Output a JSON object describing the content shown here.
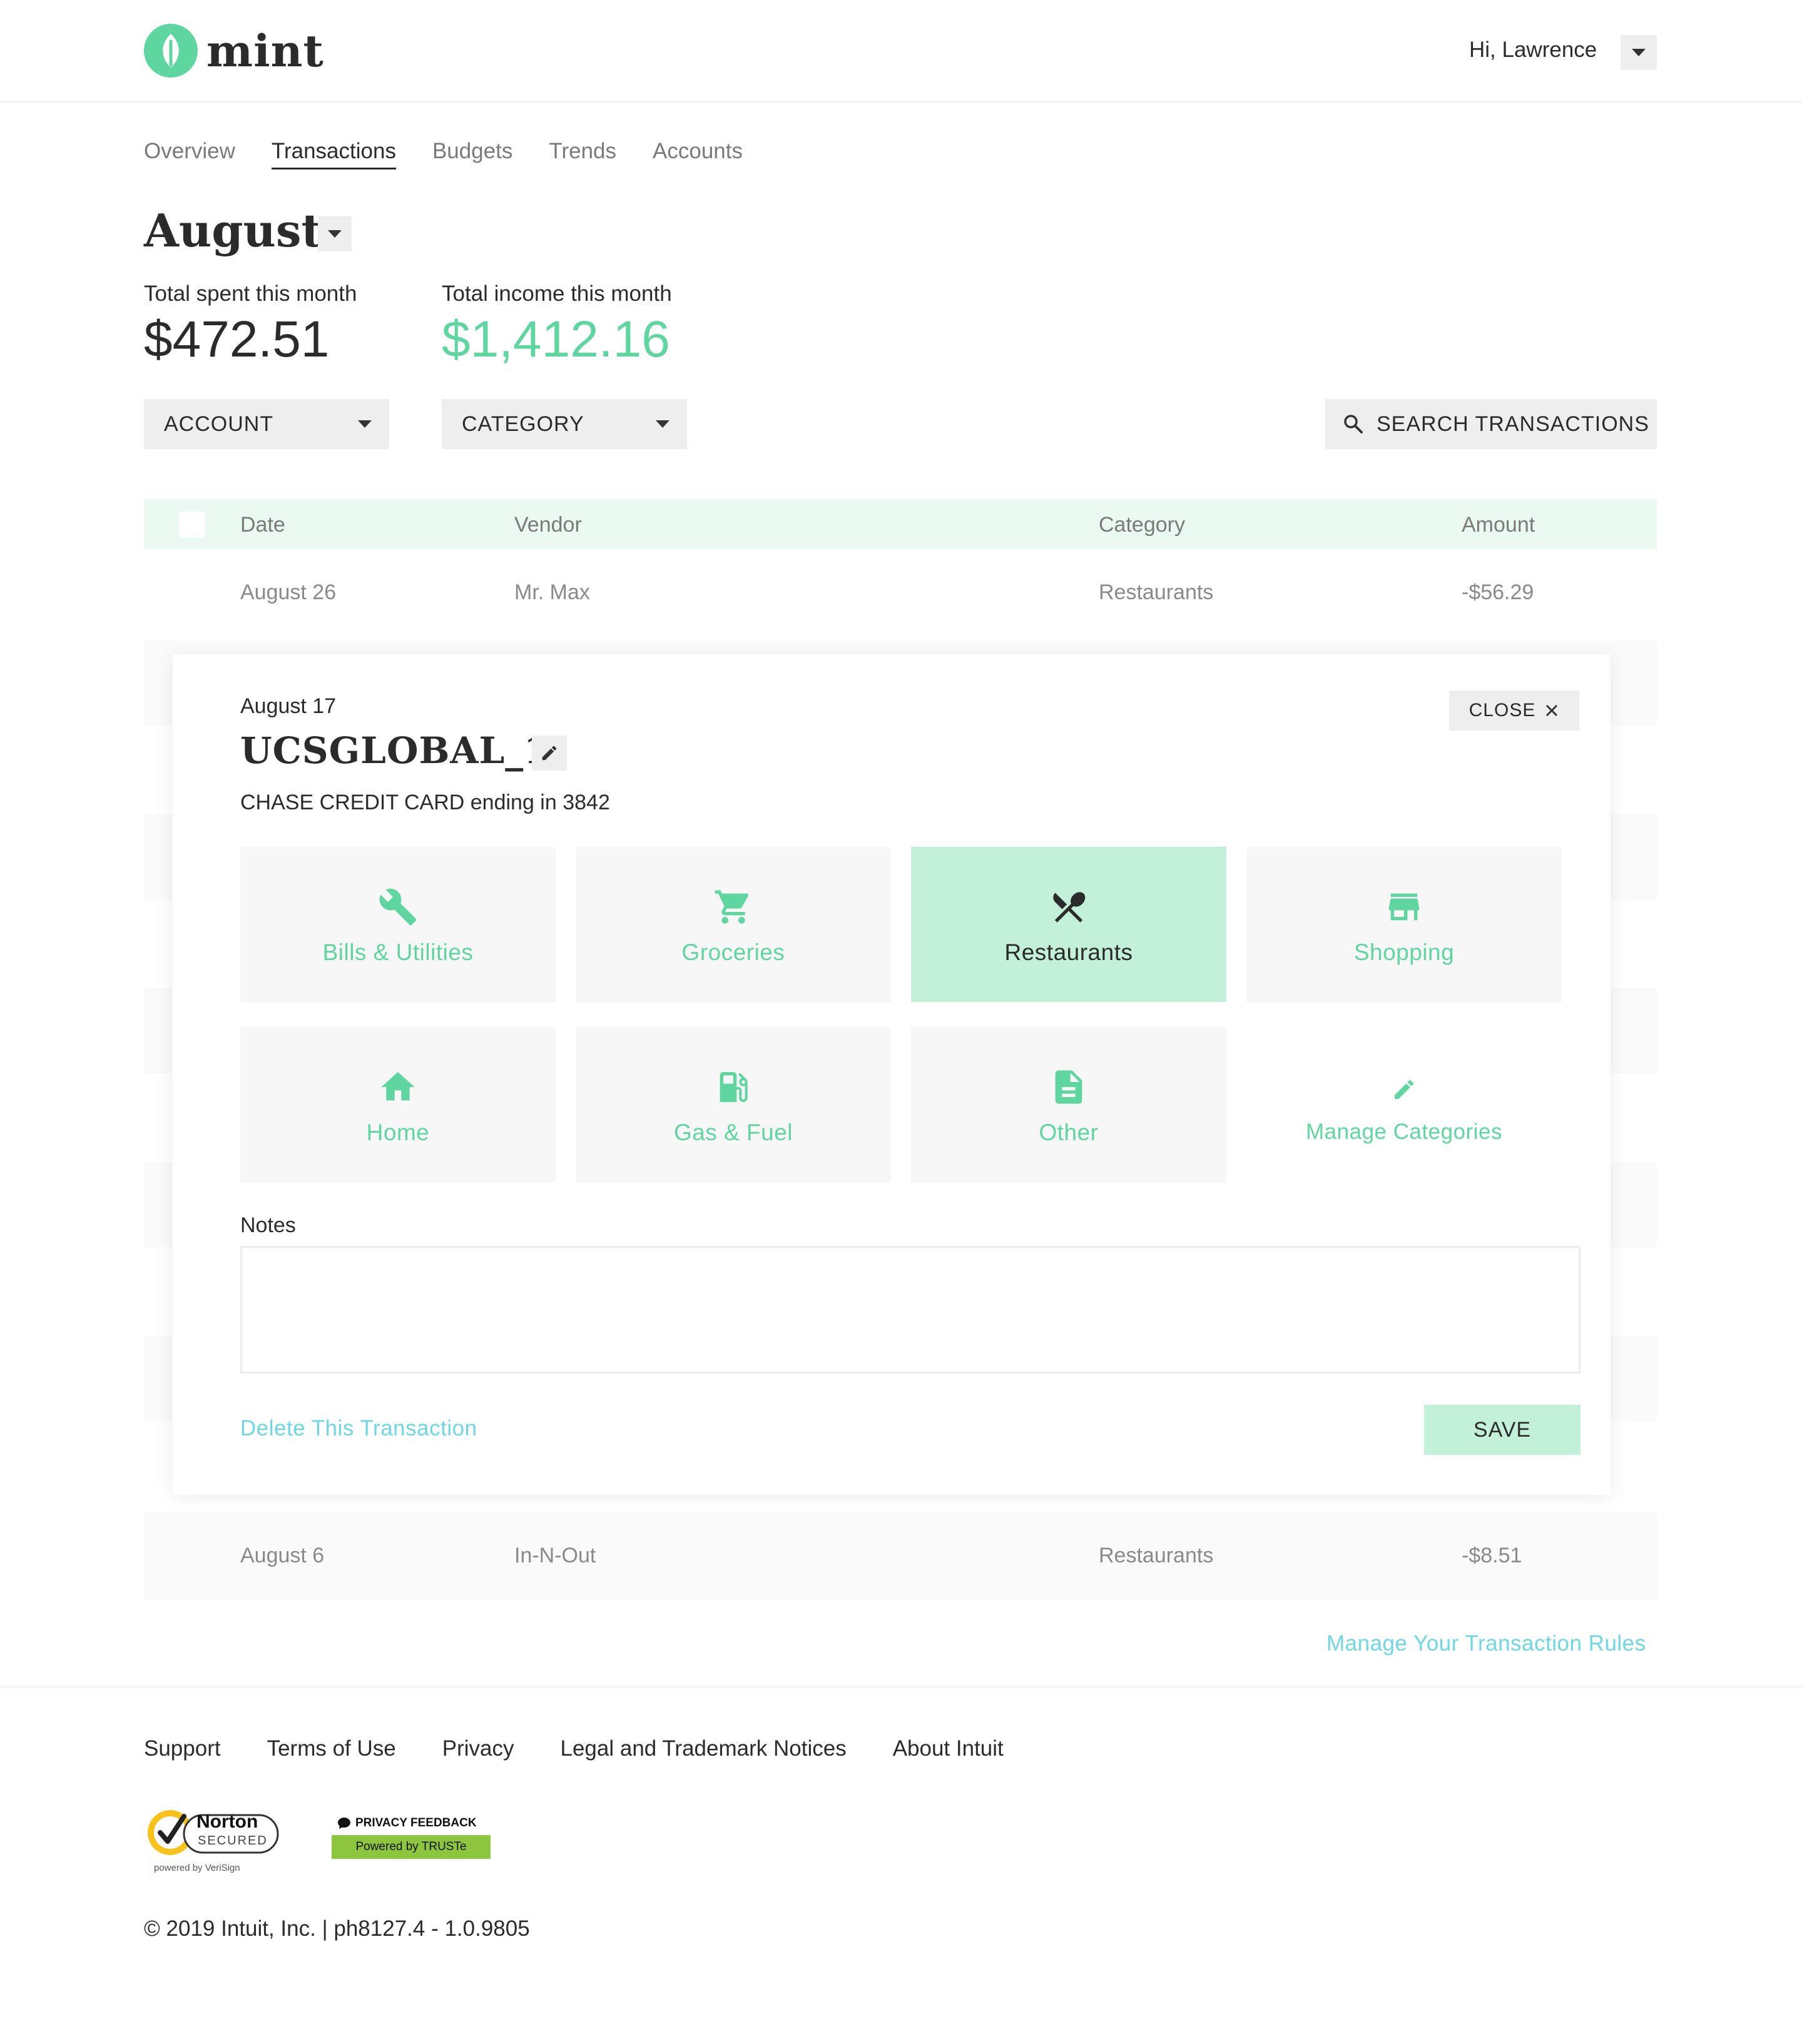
{
  "header": {
    "brand": "mint",
    "greeting": "Hi, Lawrence"
  },
  "nav": {
    "tabs": [
      {
        "label": "Overview",
        "active": false
      },
      {
        "label": "Transactions",
        "active": true
      },
      {
        "label": "Budgets",
        "active": false
      },
      {
        "label": "Trends",
        "active": false
      },
      {
        "label": "Accounts",
        "active": false
      }
    ]
  },
  "summary": {
    "month": "August",
    "spent_label": "Total spent this month",
    "spent_value": "$472.51",
    "income_label": "Total income this month",
    "income_value": "$1,412.16"
  },
  "filters": {
    "account": "ACCOUNT",
    "category": "CATEGORY",
    "search": "SEARCH TRANSACTIONS"
  },
  "table": {
    "columns": [
      "Date",
      "Vendor",
      "Category",
      "Amount"
    ],
    "rows": [
      {
        "date": "August 26",
        "vendor": "Mr. Max",
        "category": "Restaurants",
        "amount": "-$56.29"
      },
      {
        "date": "August 6",
        "vendor": "In-N-Out",
        "category": "Restaurants",
        "amount": "-$8.51"
      }
    ]
  },
  "detail": {
    "date": "August 17",
    "vendor": "UCSGLOBAL_1",
    "account": "CHASE CREDIT CARD ending in 3842",
    "close_label": "CLOSE",
    "categories": [
      {
        "label": "Bills & Utilities",
        "icon": "wrench-icon",
        "selected": false
      },
      {
        "label": "Groceries",
        "icon": "cart-icon",
        "selected": false
      },
      {
        "label": "Restaurants",
        "icon": "fork-knife-icon",
        "selected": true
      },
      {
        "label": "Shopping",
        "icon": "store-icon",
        "selected": false
      },
      {
        "label": "Home",
        "icon": "home-icon",
        "selected": false
      },
      {
        "label": "Gas & Fuel",
        "icon": "gas-pump-icon",
        "selected": false
      },
      {
        "label": "Other",
        "icon": "document-icon",
        "selected": false
      }
    ],
    "manage_categories": "Manage Categories",
    "notes_label": "Notes",
    "notes_value": "",
    "delete_label": "Delete This Transaction",
    "save_label": "SAVE"
  },
  "rules_link": "Manage Your Transaction Rules",
  "footer": {
    "links": [
      "Support",
      "Terms of Use",
      "Privacy",
      "Legal and Trademark Notices",
      "About Intuit"
    ],
    "norton": {
      "title": "Norton",
      "secured": "SECURED",
      "powered": "powered by VeriSign"
    },
    "truste": {
      "top": "PRIVACY FEEDBACK",
      "bottom": "Powered by TRUSTe"
    },
    "copyright": "© 2019 Intuit, Inc.  |  ph8127.4 - 1.0.9805"
  },
  "colors": {
    "brand_green": "#5fd6a0",
    "selected_tile": "#c2f0d8",
    "table_header": "#eafaf2",
    "link_blue": "#6fd6e4"
  }
}
